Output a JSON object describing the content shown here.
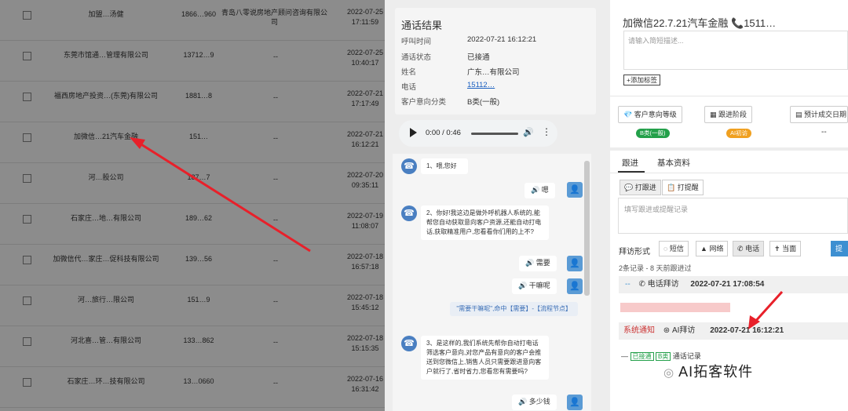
{
  "table": {
    "rows": [
      {
        "name": "加盟…汤健",
        "phone": "1866…960",
        "addr": "青岛八零说房地产顾问咨询有限公司",
        "date": "2022-07-25",
        "time": "17:11:59"
      },
      {
        "name": "东莞市馆通…管理有限公司",
        "phone": "13712…9",
        "addr": "--",
        "date": "2022-07-25",
        "time": "10:40:17"
      },
      {
        "name": "福西房地产投资…(东莞)有限公司",
        "phone": "1881…8",
        "addr": "--",
        "date": "2022-07-21",
        "time": "17:17:49"
      },
      {
        "name": "加微信…21汽车金融",
        "phone": "151…",
        "addr": "--",
        "date": "2022-07-21",
        "time": "16:12:21"
      },
      {
        "name": "河…股公司",
        "phone": "187…7",
        "addr": "--",
        "date": "2022-07-20",
        "time": "09:35:11"
      },
      {
        "name": "石家庄…地…有限公司",
        "phone": "189…62",
        "addr": "--",
        "date": "2022-07-19",
        "time": "11:08:07"
      },
      {
        "name": "加微信代…家庄…促科技有限公司",
        "phone": "139…56",
        "addr": "--",
        "date": "2022-07-18",
        "time": "16:57:18"
      },
      {
        "name": "河…旅行…限公司",
        "phone": "151…9",
        "addr": "--",
        "date": "2022-07-18",
        "time": "15:45:12"
      },
      {
        "name": "河北喜…管…有限公司",
        "phone": "133…862",
        "addr": "--",
        "date": "2022-07-18",
        "time": "15:15:35"
      },
      {
        "name": "石家庄…环…技有限公司",
        "phone": "13…0660",
        "addr": "--",
        "date": "2022-07-16",
        "time": "16:31:42"
      }
    ]
  },
  "call": {
    "title": "通话结果",
    "fields": [
      {
        "label": "呼叫时间",
        "value": "2022-07-21 16:12:21"
      },
      {
        "label": "通话状态",
        "value": "已接通"
      },
      {
        "label": "姓名",
        "value": "广东…有限公司"
      },
      {
        "label": "电话",
        "value": "15112…"
      },
      {
        "label": "客户意向分类",
        "value": "B类(一般)"
      }
    ],
    "audio_time": "0:00 / 0:46"
  },
  "chat": {
    "m1": "1、喂,您好",
    "r1": "嗯",
    "m2": "2、你好!我这边是做外呼机器人系统的,能帮您自动获取意向客户资源,还能自动打电话,获取精准用户,您看看你们用的上不?",
    "r2": "需要",
    "r3": "干嘛呢",
    "hint": "\"需要干嘛呢\",命中【需要】-【流程节点】",
    "m3": "3、是这样的,我们系统先帮你自动打电话筛选客户意向,对您产品有意向的客户会推送到您微信上,销售人员只需要跟进意向客户就行了,省时省力,您看您有需要吗?",
    "r4": "多少钱"
  },
  "right": {
    "title": "加微信22.7.21汽车金融",
    "phone": "1511…",
    "note_placeholder": "请输入简短描述...",
    "add_tag": "添加标签",
    "stat1": "客户意向等级",
    "stat2": "跟进阶段",
    "stat3": "预计成交日期",
    "pill1": "B类(一般)",
    "pill2": "AI初访",
    "dash": "--",
    "tab1": "跟进",
    "tab2": "基本资料",
    "btn_follow": "打跟进",
    "btn_remind": "打提醒",
    "follow_placeholder": "填写跟进或提醒记录",
    "visit_label": "拜访形式",
    "m_sms": "短信",
    "m_net": "网络",
    "m_phone": "电话",
    "m_face": "当面",
    "submit": "提交",
    "records": "2条记录 - 8 天前跟进过",
    "rec1_type": "电话拜访",
    "rec1_time": "2022-07-21 17:08:54",
    "sys": "系统通知",
    "rec2_type": "AI拜访",
    "rec2_time": "2022-07-21 16:12:21",
    "tag_connected": "已接通",
    "tag_b": "B类",
    "call_record": "通话记录",
    "watermark": "AI拓客软件"
  }
}
